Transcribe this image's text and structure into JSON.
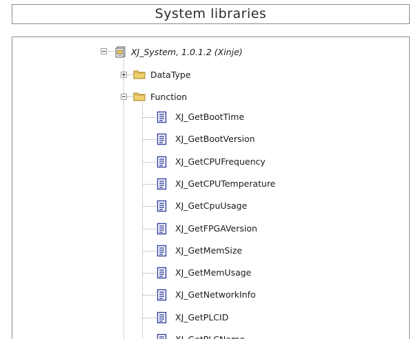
{
  "header": {
    "title": "System libraries"
  },
  "tree": {
    "root": {
      "label": "XJ_System, 1.0.1.2 (Xinje)",
      "expanded": true,
      "icon": "library-icon"
    },
    "folders": [
      {
        "label": "DataType",
        "expanded": false,
        "icon": "folder-icon"
      },
      {
        "label": "Function",
        "expanded": true,
        "icon": "folder-icon"
      }
    ],
    "functions": [
      "XJ_GetBootTime",
      "XJ_GetBootVersion",
      "XJ_GetCPUFrequency",
      "XJ_GetCPUTemperature",
      "XJ_GetCpuUsage",
      "XJ_GetFPGAVersion",
      "XJ_GetMemSize",
      "XJ_GetMemUsage",
      "XJ_GetNetworkInfo",
      "XJ_GetPLCID",
      "XJ_GetPLCName"
    ],
    "function_icon": "function-document-icon"
  },
  "colors": {
    "folder": "#e8c766",
    "doc_blue": "#2f3e9e",
    "tree_line": "#a0a0a0"
  }
}
